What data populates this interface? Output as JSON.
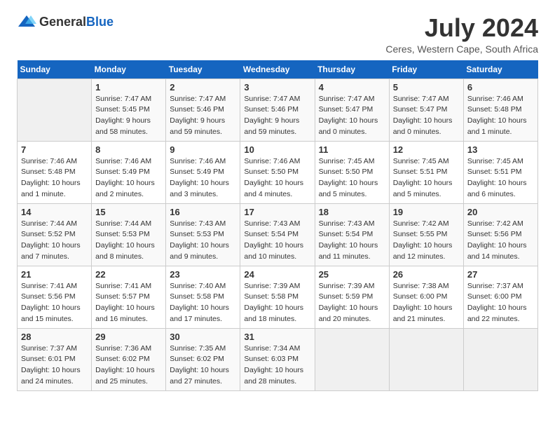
{
  "header": {
    "logo_general": "General",
    "logo_blue": "Blue",
    "month_year": "July 2024",
    "location": "Ceres, Western Cape, South Africa"
  },
  "calendar": {
    "days_of_week": [
      "Sunday",
      "Monday",
      "Tuesday",
      "Wednesday",
      "Thursday",
      "Friday",
      "Saturday"
    ],
    "weeks": [
      [
        {
          "day": "",
          "info": ""
        },
        {
          "day": "1",
          "info": "Sunrise: 7:47 AM\nSunset: 5:45 PM\nDaylight: 9 hours\nand 58 minutes."
        },
        {
          "day": "2",
          "info": "Sunrise: 7:47 AM\nSunset: 5:46 PM\nDaylight: 9 hours\nand 59 minutes."
        },
        {
          "day": "3",
          "info": "Sunrise: 7:47 AM\nSunset: 5:46 PM\nDaylight: 9 hours\nand 59 minutes."
        },
        {
          "day": "4",
          "info": "Sunrise: 7:47 AM\nSunset: 5:47 PM\nDaylight: 10 hours\nand 0 minutes."
        },
        {
          "day": "5",
          "info": "Sunrise: 7:47 AM\nSunset: 5:47 PM\nDaylight: 10 hours\nand 0 minutes."
        },
        {
          "day": "6",
          "info": "Sunrise: 7:46 AM\nSunset: 5:48 PM\nDaylight: 10 hours\nand 1 minute."
        }
      ],
      [
        {
          "day": "7",
          "info": "Sunrise: 7:46 AM\nSunset: 5:48 PM\nDaylight: 10 hours\nand 1 minute."
        },
        {
          "day": "8",
          "info": "Sunrise: 7:46 AM\nSunset: 5:49 PM\nDaylight: 10 hours\nand 2 minutes."
        },
        {
          "day": "9",
          "info": "Sunrise: 7:46 AM\nSunset: 5:49 PM\nDaylight: 10 hours\nand 3 minutes."
        },
        {
          "day": "10",
          "info": "Sunrise: 7:46 AM\nSunset: 5:50 PM\nDaylight: 10 hours\nand 4 minutes."
        },
        {
          "day": "11",
          "info": "Sunrise: 7:45 AM\nSunset: 5:50 PM\nDaylight: 10 hours\nand 5 minutes."
        },
        {
          "day": "12",
          "info": "Sunrise: 7:45 AM\nSunset: 5:51 PM\nDaylight: 10 hours\nand 5 minutes."
        },
        {
          "day": "13",
          "info": "Sunrise: 7:45 AM\nSunset: 5:51 PM\nDaylight: 10 hours\nand 6 minutes."
        }
      ],
      [
        {
          "day": "14",
          "info": "Sunrise: 7:44 AM\nSunset: 5:52 PM\nDaylight: 10 hours\nand 7 minutes."
        },
        {
          "day": "15",
          "info": "Sunrise: 7:44 AM\nSunset: 5:53 PM\nDaylight: 10 hours\nand 8 minutes."
        },
        {
          "day": "16",
          "info": "Sunrise: 7:43 AM\nSunset: 5:53 PM\nDaylight: 10 hours\nand 9 minutes."
        },
        {
          "day": "17",
          "info": "Sunrise: 7:43 AM\nSunset: 5:54 PM\nDaylight: 10 hours\nand 10 minutes."
        },
        {
          "day": "18",
          "info": "Sunrise: 7:43 AM\nSunset: 5:54 PM\nDaylight: 10 hours\nand 11 minutes."
        },
        {
          "day": "19",
          "info": "Sunrise: 7:42 AM\nSunset: 5:55 PM\nDaylight: 10 hours\nand 12 minutes."
        },
        {
          "day": "20",
          "info": "Sunrise: 7:42 AM\nSunset: 5:56 PM\nDaylight: 10 hours\nand 14 minutes."
        }
      ],
      [
        {
          "day": "21",
          "info": "Sunrise: 7:41 AM\nSunset: 5:56 PM\nDaylight: 10 hours\nand 15 minutes."
        },
        {
          "day": "22",
          "info": "Sunrise: 7:41 AM\nSunset: 5:57 PM\nDaylight: 10 hours\nand 16 minutes."
        },
        {
          "day": "23",
          "info": "Sunrise: 7:40 AM\nSunset: 5:58 PM\nDaylight: 10 hours\nand 17 minutes."
        },
        {
          "day": "24",
          "info": "Sunrise: 7:39 AM\nSunset: 5:58 PM\nDaylight: 10 hours\nand 18 minutes."
        },
        {
          "day": "25",
          "info": "Sunrise: 7:39 AM\nSunset: 5:59 PM\nDaylight: 10 hours\nand 20 minutes."
        },
        {
          "day": "26",
          "info": "Sunrise: 7:38 AM\nSunset: 6:00 PM\nDaylight: 10 hours\nand 21 minutes."
        },
        {
          "day": "27",
          "info": "Sunrise: 7:37 AM\nSunset: 6:00 PM\nDaylight: 10 hours\nand 22 minutes."
        }
      ],
      [
        {
          "day": "28",
          "info": "Sunrise: 7:37 AM\nSunset: 6:01 PM\nDaylight: 10 hours\nand 24 minutes."
        },
        {
          "day": "29",
          "info": "Sunrise: 7:36 AM\nSunset: 6:02 PM\nDaylight: 10 hours\nand 25 minutes."
        },
        {
          "day": "30",
          "info": "Sunrise: 7:35 AM\nSunset: 6:02 PM\nDaylight: 10 hours\nand 27 minutes."
        },
        {
          "day": "31",
          "info": "Sunrise: 7:34 AM\nSunset: 6:03 PM\nDaylight: 10 hours\nand 28 minutes."
        },
        {
          "day": "",
          "info": ""
        },
        {
          "day": "",
          "info": ""
        },
        {
          "day": "",
          "info": ""
        }
      ]
    ]
  }
}
